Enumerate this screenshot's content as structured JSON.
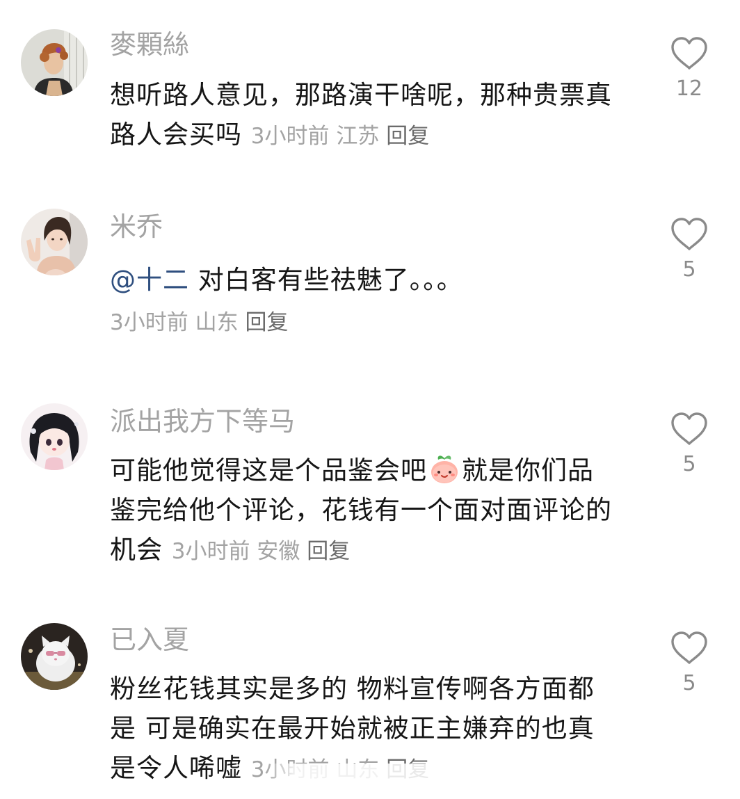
{
  "comments": [
    {
      "username": "麥顆絲",
      "content": "想听路人意见，那路演干啥呢，那种贵票真路人会买吗",
      "time": "3小时前",
      "location": "江苏",
      "reply_label": "回复",
      "likes": "12",
      "avatar": "avatar-woman-curly-hair"
    },
    {
      "username": "米乔",
      "mention": "@十二",
      "content": "对白客有些祛魅了。。。",
      "time": "3小时前",
      "location": "山东",
      "reply_label": "回复",
      "likes": "5",
      "avatar": "avatar-woman-peace-sign"
    },
    {
      "username": "派出我方下等马",
      "content_before_emoji": "可能他觉得这是个品鉴会吧",
      "emoji": "peach-face-emoji",
      "content_after_emoji": "就是你们品鉴完给他个评论，花钱有一个面对面评论的机会",
      "time": "3小时前",
      "location": "安徽",
      "reply_label": "回复",
      "likes": "5",
      "avatar": "avatar-anime-girl"
    },
    {
      "username": "已入夏",
      "content": "粉丝花钱其实是多的 物料宣传啊各方面都是 可是确实在最开始就被正主嫌弃的也真是令人唏嘘",
      "time": "3小时前",
      "location": "山东",
      "reply_label": "回复",
      "likes": "5",
      "avatar": "avatar-white-cat"
    }
  ],
  "icons": {
    "like": "heart-outline-icon"
  },
  "colors": {
    "username": "#a3a3a3",
    "text": "#161616",
    "mention": "#2f4f7f",
    "meta": "#a3a3a3",
    "reply": "#6b6b6b",
    "heart": "#8a8a8a"
  }
}
